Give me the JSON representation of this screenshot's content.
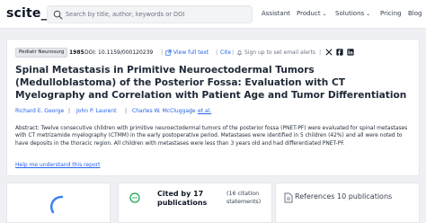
{
  "header": {
    "logo": "scite_",
    "search_placeholder": "Search by title, author, keywords or DOI",
    "nav": {
      "assistant": "Assistant",
      "product": "Product",
      "solutions": "Solutions",
      "pricing": "Pricing",
      "blog": "Blog"
    }
  },
  "article": {
    "journal": "Pediatr Neurosurg",
    "year": "1985",
    "doi": "DOI: 10.1159/000120239",
    "view_full_text": "View full text",
    "cite": "Cite",
    "email_alerts": "Sign up to set email alerts",
    "title": "Spinal Metastasis in Primitive Neuroectodermal Tumors (Medulloblastoma) of the Posterior Fossa: Evaluation with CT Myelography and Correlation with Patient Age and Tumor Differentiation",
    "authors": [
      "Richard E. George",
      "John P. Laurent",
      "Charles W. McCluggage",
      "et al."
    ],
    "abstract": "Abstract: Twelve consecutive children with primitive neuroectodermal tumors of the posterior fossa (PNET-PF) were evaluated for spinal metastases with CT metrizamide myelography (CTMM) in the early postoperative period. Metastases were identified in 5 children (42%) and all were noted to have deposits in the thoracic region. All children with metastases were less than 3 years old and had differentiated PNET-PF.",
    "help_link": "Help me understand this report"
  },
  "panels": {
    "cited_by": "Cited by 17 publications",
    "citation_statements": "(16 citation statements)",
    "references": "References 10 publications"
  },
  "colors": {
    "link": "#2563eb",
    "accent_green": "#16a34a",
    "spinner": "#3b82f6"
  }
}
